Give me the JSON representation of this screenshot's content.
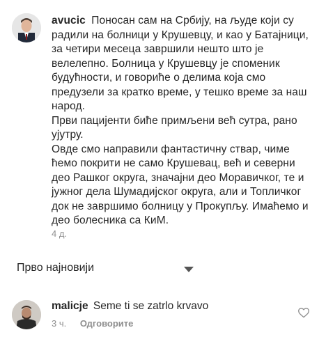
{
  "post": {
    "username": "avucic",
    "text": "Поносан сам на Србију, на људе који су радили на болници у Крушевцу, и као у Батајници, за четири месеца завршили нешто што је велелепно. Болница у Крушевцу је споменик будућности, и говориће о делима која смо предузели за кратко време, у тешко време за наш народ.\nПрви пацијенти биће примљени већ сутра, рано ујутру.\nОвде смо направили фантастичну ствар, чиме ћемо покрити не само Крушевац, већ и северни део Рашког округа, значајни део Моравичког, те и јужног дела Шумадијског округа, али и Топличког док не завршимо болницу у Прокупљу. Имаћемо и део болесника са КиМ.",
    "time": "4 д."
  },
  "sort": {
    "label": "Прво најновији"
  },
  "reply": {
    "username": "malicje",
    "text": "Seme ti se zatrlo krvavo",
    "time": "3 ч.",
    "reply_label": "Одговорите"
  },
  "icons": {
    "sort": "chevron-down-icon",
    "like": "heart-icon"
  }
}
